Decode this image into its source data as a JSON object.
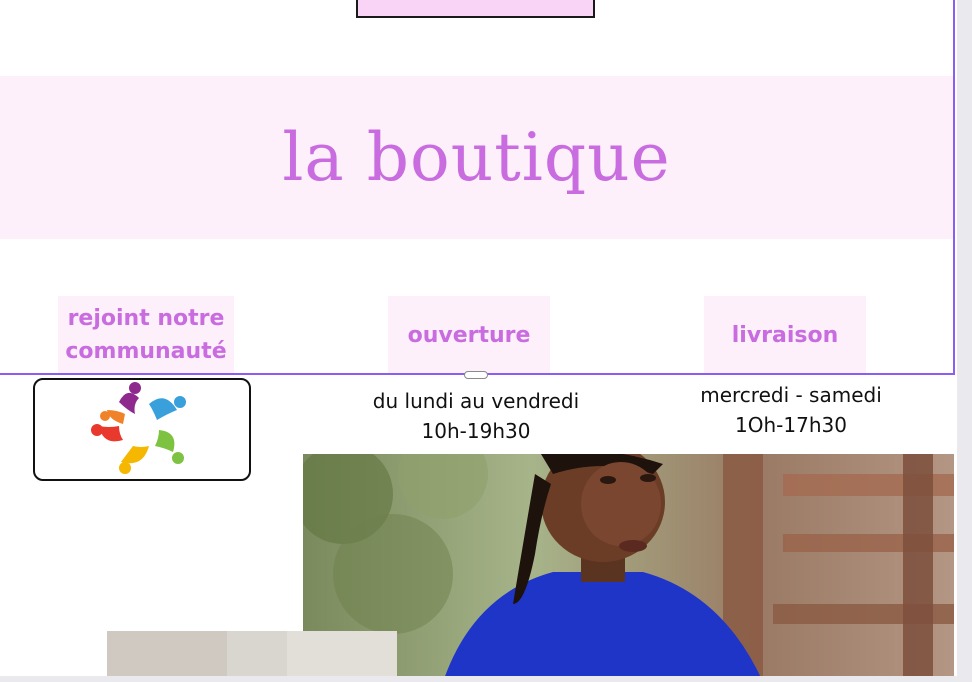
{
  "title_band": {
    "title": "la boutique"
  },
  "tiles": [
    {
      "label": "rejoint notre communauté"
    },
    {
      "label": "ouverture"
    },
    {
      "label": "livraison"
    }
  ],
  "hours": {
    "weekdays": "du lundi au vendredi",
    "weekday_time": "10h-19h30",
    "delivery_days": "mercredi - samedi",
    "delivery_time": "1Oh-17h30"
  },
  "logo": {
    "icon": "community-people-circle-icon"
  },
  "photos": [
    {
      "name": "woman-blue-shirt-photo"
    },
    {
      "name": "small-photo"
    }
  ],
  "colors": {
    "accent": "#c86ce0",
    "band_background": "#fdf0fb",
    "selection": "#8b5cf6",
    "top_box": "#fad4f7"
  }
}
